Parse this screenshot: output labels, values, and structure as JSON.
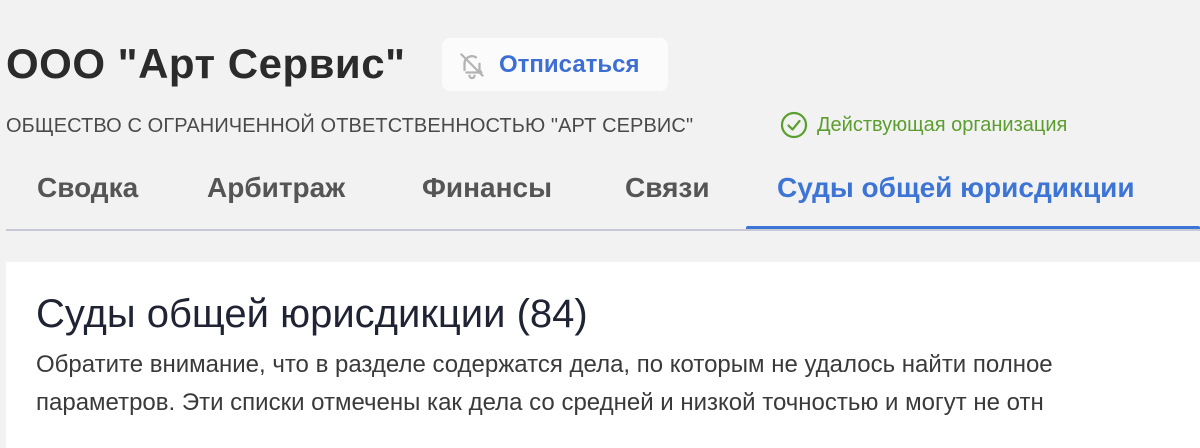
{
  "header": {
    "company_short_name": "ООО \"Арт Сервис\"",
    "unsubscribe_label": "Отписаться",
    "unsubscribe_icon": "bell-off-icon",
    "company_full_name": "ОБЩЕСТВО С ОГРАНИЧЕННОЙ ОТВЕТСТВЕННОСТЬЮ \"АРТ СЕРВИС\"",
    "status_label": "Действующая организация",
    "status_icon": "check-circle-icon"
  },
  "tabs": [
    {
      "label": "Сводка",
      "active": false
    },
    {
      "label": "Арбитраж",
      "active": false
    },
    {
      "label": "Финансы",
      "active": false
    },
    {
      "label": "Связи",
      "active": false
    },
    {
      "label": "Суды общей юрисдикции",
      "active": true
    }
  ],
  "section": {
    "title": "Суды общей юрисдикции (84)",
    "notice_line1": "Обратите внимание, что в разделе содержатся дела, по которым не удалось найти полное",
    "notice_line2": "параметров. Эти списки отмечены как дела со средней и низкой точностью и могут не отн"
  },
  "colors": {
    "accent": "#3d75d6",
    "status": "#5b9e2e",
    "background": "#f2f2f2",
    "panel": "#ffffff"
  }
}
